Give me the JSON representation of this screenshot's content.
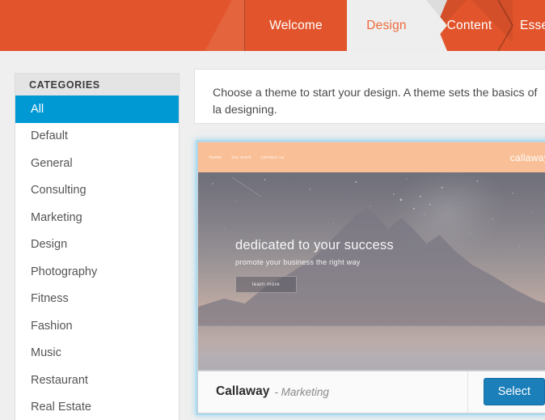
{
  "header": {
    "steps": [
      {
        "label": "Welcome",
        "active": false
      },
      {
        "label": "Design",
        "active": true
      },
      {
        "label": "Content",
        "active": false
      },
      {
        "label": "Esse",
        "active": false
      }
    ],
    "accent_color": "#e2552c",
    "active_step_bg": "#eeeeee",
    "active_step_text": "#ef6a3c"
  },
  "sidebar": {
    "title": "CATEGORIES",
    "selected": "All",
    "highlight_color": "#0099d4",
    "items": [
      {
        "label": "All"
      },
      {
        "label": "Default"
      },
      {
        "label": "General"
      },
      {
        "label": "Consulting"
      },
      {
        "label": "Marketing"
      },
      {
        "label": "Design"
      },
      {
        "label": "Photography"
      },
      {
        "label": "Fitness"
      },
      {
        "label": "Fashion"
      },
      {
        "label": "Music"
      },
      {
        "label": "Restaurant"
      },
      {
        "label": "Real Estate"
      }
    ]
  },
  "main": {
    "notice": "Choose a theme to start your design. A theme sets the basics of la designing.",
    "theme_card": {
      "name": "Callaway",
      "category": "- Marketing",
      "select_label": "Select",
      "select_color": "#1b7fba",
      "highlight_glow": "#aadcf2",
      "preview": {
        "logo": "callaway",
        "nav_links": [
          "home",
          "our work",
          "contact us"
        ],
        "hero_title": "dedicated to your success",
        "hero_subtitle": "promote your business the right way",
        "hero_button": "learn more",
        "nav_bg": "#f9bf96"
      }
    }
  }
}
